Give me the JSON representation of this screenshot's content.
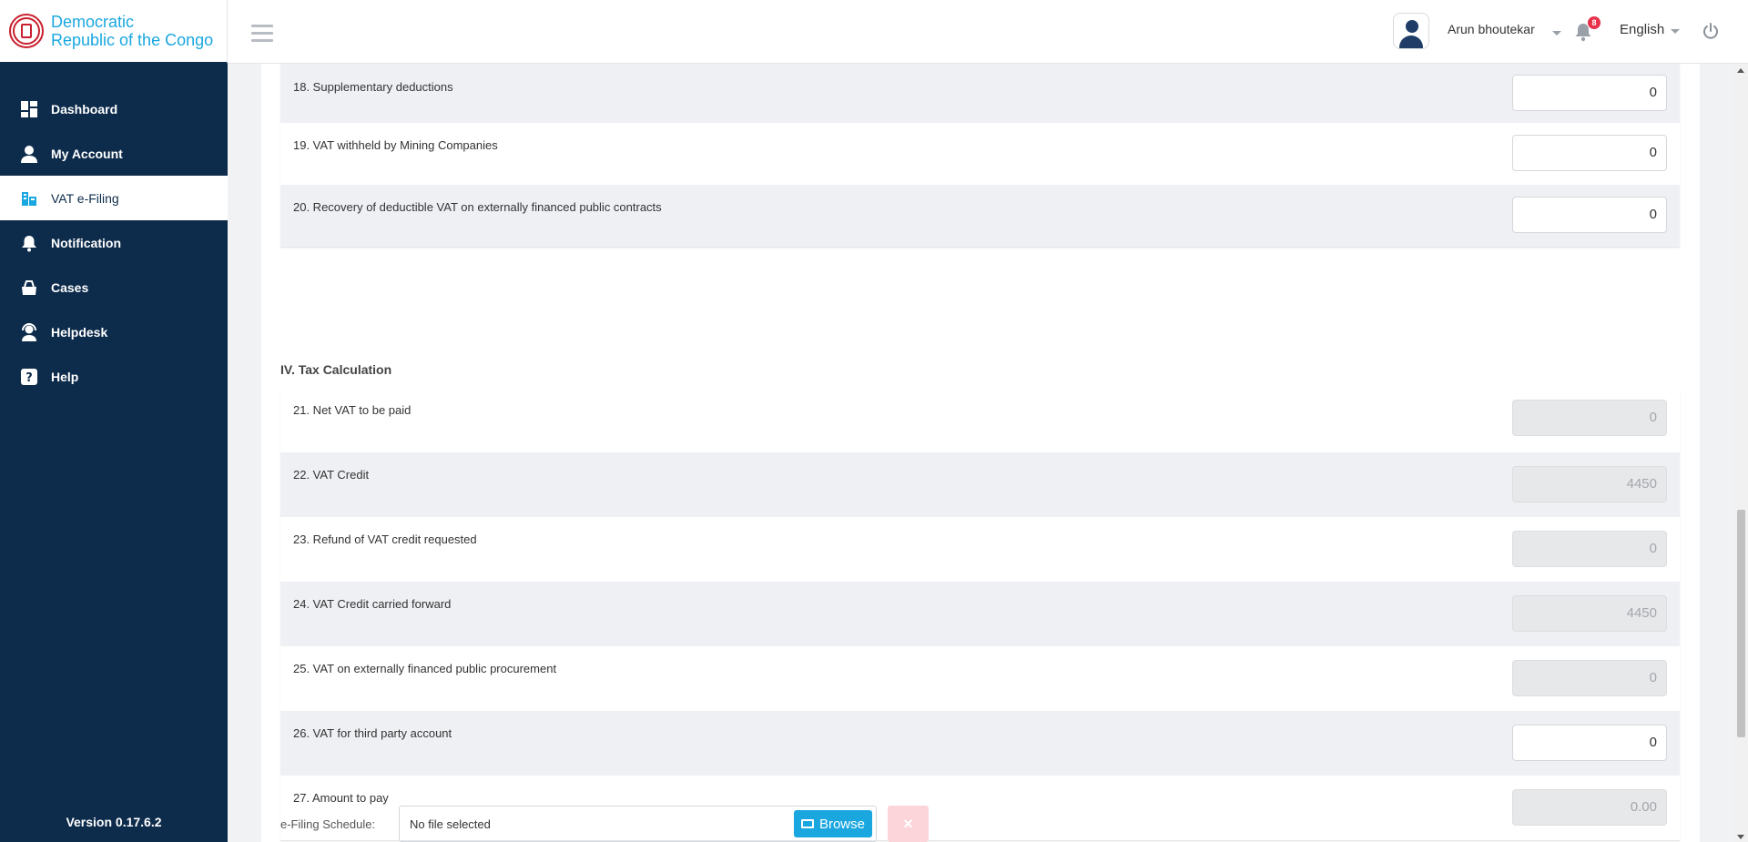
{
  "brand": {
    "line1": "Democratic",
    "line2": "Republic of the Congo"
  },
  "sidebar": {
    "items": [
      {
        "label": "Dashboard",
        "icon": "dashboard-icon"
      },
      {
        "label": "My Account",
        "icon": "user-icon"
      },
      {
        "label": "VAT e-Filing",
        "icon": "filing-icon"
      },
      {
        "label": "Notification",
        "icon": "bell-icon"
      },
      {
        "label": "Cases",
        "icon": "cases-icon"
      },
      {
        "label": "Helpdesk",
        "icon": "helpdesk-icon"
      },
      {
        "label": "Help",
        "icon": "help-icon"
      }
    ],
    "active": "VAT e-Filing",
    "version": "Version 0.17.6.2"
  },
  "header": {
    "username": "Arun bhoutekar",
    "notification_count": "8",
    "language": "English"
  },
  "form": {
    "top_rows": [
      {
        "label": "18. Supplementary deductions",
        "value": "0"
      },
      {
        "label": "19. VAT withheld by Mining Companies",
        "value": "0"
      },
      {
        "label": "20. Recovery of deductible VAT on externally financed public contracts",
        "value": "0"
      }
    ],
    "section_title": "IV. Tax Calculation",
    "calc_rows": [
      {
        "label": "21. Net VAT to be paid",
        "value": "0",
        "disabled": true
      },
      {
        "label": "22. VAT Credit",
        "value": "4450",
        "disabled": true
      },
      {
        "label": "23. Refund of VAT credit requested",
        "value": "0",
        "disabled": true
      },
      {
        "label": "24. VAT Credit carried forward",
        "value": "4450",
        "disabled": true
      },
      {
        "label": "25. VAT on externally financed public procurement",
        "value": "0",
        "disabled": true
      },
      {
        "label": "26. VAT for third party account",
        "value": "0",
        "disabled": false
      },
      {
        "label": "27. Amount to pay",
        "value": "0.00",
        "disabled": true
      }
    ]
  },
  "efiling": {
    "label": "e-Filing Schedule:",
    "file_text": "No file selected",
    "browse_label": "Browse",
    "clear_label": "×"
  },
  "colors": {
    "sidebar": "#0d2b4b",
    "accent": "#1aa7e0",
    "badge": "#e8304a"
  }
}
